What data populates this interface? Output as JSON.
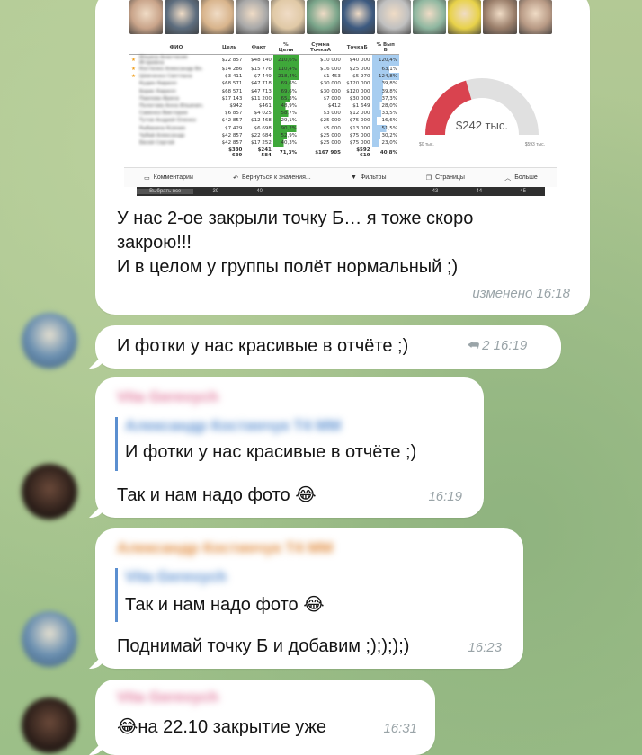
{
  "report": {
    "columns": [
      "ФИО",
      "Цель",
      "Факт",
      "% Цели",
      "Сумма ТочкаА",
      "ТочкаБ",
      "% Вып Б"
    ],
    "rows": [
      {
        "star": true,
        "name": "Ильина Анастасия Игоревна",
        "goal": "$22 857",
        "fact": "$48 140",
        "pct": "210,6%",
        "a": "$10 000",
        "b": "$40 000",
        "pb": "120,4%"
      },
      {
        "star": true,
        "name": "Костенко Александр Вл.",
        "goal": "$14 286",
        "fact": "$15 776",
        "pct": "110,4%",
        "a": "$16 000",
        "b": "$25 000",
        "pb": "63,1%"
      },
      {
        "star": true,
        "name": "Шевченко Светлана",
        "goal": "$3 411",
        "fact": "$7 449",
        "pct": "218,4%",
        "a": "$1 453",
        "b": "$5 970",
        "pb": "124,8%"
      },
      {
        "star": false,
        "name": "Кудин Кирилл",
        "goal": "$68 571",
        "fact": "$47 718",
        "pct": "69,6%",
        "a": "$30 000",
        "b": "$120 000",
        "pb": "39,8%"
      },
      {
        "star": false,
        "name": "Борис Кирилл",
        "goal": "$68 571",
        "fact": "$47 713",
        "pct": "69,6%",
        "a": "$30 000",
        "b": "$120 000",
        "pb": "39,8%"
      },
      {
        "star": false,
        "name": "Павлова Ирина",
        "goal": "$17 143",
        "fact": "$11 200",
        "pct": "65,3%",
        "a": "$7 000",
        "b": "$30 000",
        "pb": "37,3%"
      },
      {
        "star": false,
        "name": "Пологова Анна Ильинич.",
        "goal": "$942",
        "fact": "$461",
        "pct": "48,9%",
        "a": "$412",
        "b": "$1 649",
        "pb": "28,0%"
      },
      {
        "star": false,
        "name": "Савенко Виктория",
        "goal": "$6 857",
        "fact": "$4 025",
        "pct": "58,7%",
        "a": "$3 000",
        "b": "$12 000",
        "pb": "33,5%"
      },
      {
        "star": false,
        "name": "Тутов Андрей Оленко",
        "goal": "$42 857",
        "fact": "$12 468",
        "pct": "29,1%",
        "a": "$25 000",
        "b": "$75 000",
        "pb": "16,6%"
      },
      {
        "star": false,
        "name": "Рыбакина Ксения",
        "goal": "$7 429",
        "fact": "$6 698",
        "pct": "90,2%",
        "a": "$5 000",
        "b": "$13 000",
        "pb": "51,5%"
      },
      {
        "star": false,
        "name": "Чубай Александр",
        "goal": "$42 857",
        "fact": "$22 684",
        "pct": "52,9%",
        "a": "$25 000",
        "b": "$75 000",
        "pb": "30,2%"
      },
      {
        "star": false,
        "name": "Евсей Сергей",
        "goal": "$42 857",
        "fact": "$17 252",
        "pct": "40,3%",
        "a": "$25 000",
        "b": "$75 000",
        "pb": "23,0%"
      }
    ],
    "total": {
      "goal": "$330 639",
      "fact": "$241 584",
      "pct": "71,3%",
      "a": "$167 905",
      "b": "$592 619",
      "pb": "40,8%"
    },
    "gauge": {
      "value_label": "$242 тыс.",
      "min_label": "$0 тыс.",
      "max_label": "$593 тыс.",
      "fraction": 0.408
    },
    "toolbar": [
      "Комментарии",
      "Вернуться к значения...",
      "Фильтры",
      "Страницы",
      "Больше"
    ],
    "scroller": [
      "Выбрать все",
      "39",
      "40",
      "42",
      "43",
      "44",
      "45"
    ]
  },
  "messages": [
    {
      "id": "m1",
      "text": "У нас 2-ое закрыли точку Б… я тоже скоро\nзакрою!!!\nИ в целом у группы полёт нормальный ;)",
      "time": "изменено 16:18"
    },
    {
      "id": "m2",
      "text": "И фотки у нас красивые в отчёте ;)",
      "replies": "2",
      "time": "16:19"
    },
    {
      "id": "m3",
      "sender": "Vita Gerevych",
      "quote_name": "Александр Костинчук Т4 ММ",
      "quote_text": "И фотки у нас красивые в отчёте ;)",
      "text": "Так и нам надо фото 😂",
      "time": "16:19"
    },
    {
      "id": "m4",
      "sender": "Александр Костинчук Т4 ММ",
      "quote_name": "Vita Gerevych",
      "quote_text": "Так и нам надо фото 😂",
      "text": "Поднимай точку Б и добавим ;);););)",
      "time": "16:23"
    },
    {
      "id": "m5",
      "sender": "Vita Gerevych",
      "text": "😂на 22.10 закрытие уже",
      "time": "16:31"
    }
  ],
  "colors": {
    "accent_blue": "#5b8fd0",
    "sender_pink": "#e27ea0",
    "sender_orange": "#e0893a",
    "sender_blue": "#6c9fe0",
    "gauge_red": "#d9434f",
    "gauge_grey": "#e0e0e0",
    "bar_green": "#3fa83a"
  },
  "icons": {
    "reply": "reply-arrow-icon",
    "comment": "comment-icon",
    "back": "undo-icon",
    "filter": "filter-icon",
    "pages": "pages-icon",
    "more": "chevron-up-icon",
    "star": "star-icon"
  }
}
